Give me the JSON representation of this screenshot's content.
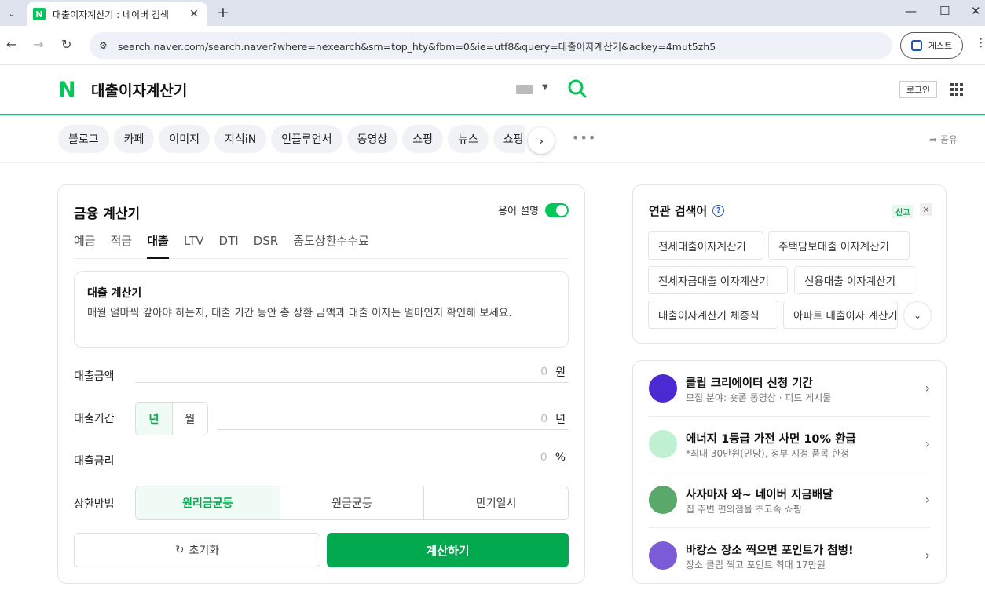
{
  "browser": {
    "tab_title": "대출이자계산기 : 네이버 검색",
    "url": "search.naver.com/search.naver?where=nexearch&sm=top_hty&fbm=0&ie=utf8&query=대출이자계산기&ackey=4mut5zh5",
    "guest_label": "게스트"
  },
  "header": {
    "logo": "N",
    "query": "대출이자계산기",
    "login_label": "로그인"
  },
  "categories": {
    "items": [
      "블로그",
      "카페",
      "이미지",
      "지식iN",
      "인플루언서",
      "동영상",
      "쇼핑",
      "뉴스",
      "쇼핑"
    ],
    "more": "•••",
    "share_label": "공유"
  },
  "calculator": {
    "title": "금융 계산기",
    "term_label": "용어 설명",
    "tabs": [
      "예금",
      "적금",
      "대출",
      "LTV",
      "DTI",
      "DSR",
      "중도상환수수료"
    ],
    "active_tab": "대출",
    "info_title": "대출 계산기",
    "info_desc": "매월 얼마씩 갚아야 하는지, 대출 기간 동안 총 상환 금액과 대출 이자는 얼마인지 확인해 보세요.",
    "amount": {
      "label": "대출금액",
      "value": "0",
      "unit": "원"
    },
    "period": {
      "label": "대출기간",
      "value": "0",
      "unit": "년",
      "options": [
        "년",
        "월"
      ]
    },
    "rate": {
      "label": "대출금리",
      "value": "0",
      "unit": "%"
    },
    "method": {
      "label": "상환방법",
      "options": [
        "원리금균등",
        "원금균등",
        "만기일시"
      ]
    },
    "reset_label": "초기화",
    "calc_label": "계산하기"
  },
  "related": {
    "title": "연관 검색어",
    "report_label": "신고",
    "chips": [
      "전세대출이자계산기",
      "주택담보대출 이자계산기",
      "전세자금대출 이자계산기",
      "신용대출 이자계산기",
      "대출이자계산기 체증식",
      "아파트 대출이자 계산기"
    ]
  },
  "promos": [
    {
      "title": "클립 크리에이터 신청 기간",
      "sub": "모집 분야: 숏폼 동영상 · 피드 게시물",
      "color": "#4b2bd1"
    },
    {
      "title": "에너지 1등급 가전 사면 10% 환급",
      "sub": "*최대 30만원(인당), 정부 지정 품목 한정",
      "color": "#bff0d2"
    },
    {
      "title": "사자마자 와~ 네이버 지금배달",
      "sub": "집 주변 편의점을 초고속 쇼핑",
      "color": "#5aa86a"
    },
    {
      "title": "바캉스 장소 찍으면 포인트가 첨벙!",
      "sub": "장소 클립 찍고 포인트 최대 17만원",
      "color": "#7b5cd6"
    }
  ],
  "colors": {
    "brand": "#03c75a",
    "accent": "#03a94f"
  }
}
